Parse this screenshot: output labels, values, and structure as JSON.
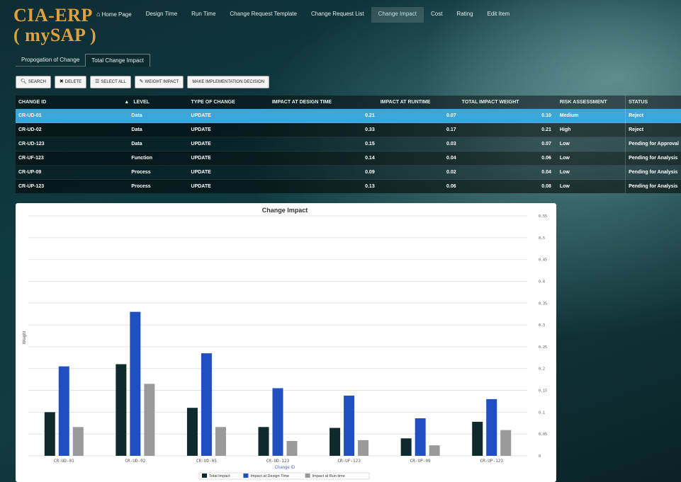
{
  "logo": {
    "line1": "CIA-ERP",
    "line2": "( mySAP )"
  },
  "nav": [
    {
      "label": "Home Page",
      "icon": "home-icon",
      "active": false
    },
    {
      "label": "Design Time",
      "active": false
    },
    {
      "label": "Run Time",
      "active": false
    },
    {
      "label": "Change Request Template",
      "active": false
    },
    {
      "label": "Change Request List",
      "active": false
    },
    {
      "label": "Change Impact",
      "active": true
    },
    {
      "label": "Cost",
      "active": false
    },
    {
      "label": "Rating",
      "active": false
    },
    {
      "label": "Edit Item",
      "active": false
    }
  ],
  "subtabs": [
    {
      "label": "Propogation of Change",
      "active": false
    },
    {
      "label": "Total Change Impact",
      "active": true
    }
  ],
  "toolbar": {
    "search": "SEARCH",
    "delete": "DELETE",
    "select_all": "SELECT ALL",
    "weight_impact": "WEIGHT IMPACT",
    "make_decision": "MAKE IMPLEMENTATION DECISION"
  },
  "table": {
    "headers": [
      "CHANGE ID",
      "LEVEL",
      "TYPE OF CHANGE",
      "IMPACT AT DESIGN TIME",
      "IMPACT AT RUNTIME",
      "TOTAL IMPACT WEIGHT",
      "RISK ASSESSMENT",
      "STATUS"
    ],
    "sort_indicator": "▲",
    "rows": [
      {
        "id": "CR-UD-01",
        "level": "Data",
        "type": "UPDATE",
        "design": "0.21",
        "runtime": "0.07",
        "total": "0.10",
        "risk": "Medium",
        "status": "Reject",
        "selected": true
      },
      {
        "id": "CR-UD-02",
        "level": "Data",
        "type": "UPDATE",
        "design": "0.33",
        "runtime": "0.17",
        "total": "0.21",
        "risk": "High",
        "status": "Reject",
        "selected": false
      },
      {
        "id": "CR-UD-123",
        "level": "Data",
        "type": "UPDATE",
        "design": "0.15",
        "runtime": "0.03",
        "total": "0.07",
        "risk": "Low",
        "status": "Pending for Approval",
        "selected": false
      },
      {
        "id": "CR-UF-123",
        "level": "Function",
        "type": "UPDATE",
        "design": "0.14",
        "runtime": "0.04",
        "total": "0.06",
        "risk": "Low",
        "status": "Pending for Analysis",
        "selected": false
      },
      {
        "id": "CR-UP-09",
        "level": "Process",
        "type": "UPDATE",
        "design": "0.09",
        "runtime": "0.02",
        "total": "0.04",
        "risk": "Low",
        "status": "Pending for Analysis",
        "selected": false
      },
      {
        "id": "CR-UP-123",
        "level": "Process",
        "type": "UPDATE",
        "design": "0.13",
        "runtime": "0.06",
        "total": "0.08",
        "risk": "Low",
        "status": "Pending for Analysis",
        "selected": false
      }
    ]
  },
  "colors": {
    "selected_row": "#3aa6db",
    "total_impact": "#0f2a2a",
    "design_time": "#1f4fc1",
    "run_time": "#999999",
    "logo": "#e0a13c"
  },
  "chart_data": {
    "type": "bar",
    "title": "Change Impact",
    "xlabel": "Change ID",
    "ylabel": "Weight",
    "ylim": [
      0,
      0.55
    ],
    "yticks": [
      "0",
      "0.05",
      "0.1",
      "0.15",
      "0.2",
      "0.25",
      "0.3",
      "0.35",
      "0.4",
      "0.45",
      "0.5",
      "0.55"
    ],
    "grid": true,
    "legend_position": "bottom",
    "categories": [
      "CR-UD-01",
      "CR-UD-02",
      "CR-UD-05",
      "CR-UD-123",
      "CR-UF-123",
      "CR-UP-09",
      "CR-UP-123"
    ],
    "series": [
      {
        "name": "Total Impact",
        "color": "#0f2a2a",
        "values": [
          0.1,
          0.21,
          0.11,
          0.066,
          0.064,
          0.04,
          0.078
        ]
      },
      {
        "name": "Impact at Design Time",
        "color": "#1f4fc1",
        "values": [
          0.205,
          0.33,
          0.235,
          0.155,
          0.138,
          0.086,
          0.13
        ]
      },
      {
        "name": "Impact at Run time",
        "color": "#999999",
        "values": [
          0.066,
          0.165,
          0.066,
          0.034,
          0.036,
          0.024,
          0.059
        ]
      }
    ]
  }
}
